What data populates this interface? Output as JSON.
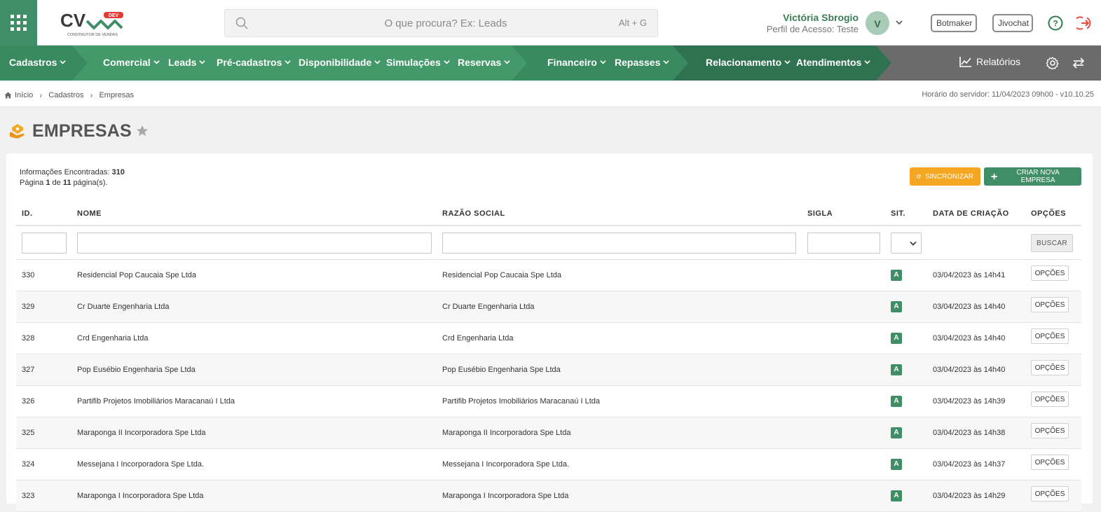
{
  "topbar": {
    "search_placeholder": "O que procura? Ex: Leads",
    "search_shortcut": "Alt + G",
    "logo_text": "CV",
    "logo_badge": "DEV",
    "logo_tagline": "CONSTRUTOR DE VENDAS",
    "user_name": "Victória Sbrogio",
    "user_profile": "Perfil de Acesso: Teste",
    "avatar_initial": "V",
    "botmaker_label": "Botmaker",
    "jivochat_label": "Jivochat"
  },
  "menu": {
    "cadastros": "Cadastros",
    "comercial": "Comercial",
    "leads": "Leads",
    "pre_cadastros": "Pré-cadastros",
    "disponibilidade": "Disponibilidade",
    "simulacoes": "Simulações",
    "reservas": "Reservas",
    "financeiro": "Financeiro",
    "repasses": "Repasses",
    "relacionamento": "Relacionamento",
    "atendimentos": "Atendimentos",
    "relatorios": "Relatórios"
  },
  "breadcrumb": {
    "home": "Início",
    "cadastros": "Cadastros",
    "current": "Empresas",
    "server_time": "Horário do servidor: 11/04/2023 09h00 - v10.10.25"
  },
  "page": {
    "title": "EMPRESAS"
  },
  "info": {
    "found_label": "Informações Encontradas:",
    "found_count": "310",
    "page_prefix": "Página",
    "page_current": "1",
    "page_of": "de",
    "page_total": "11",
    "page_suffix": "página(s)."
  },
  "actions": {
    "sync_label": "SINCRONIZAR",
    "new_label": "CRIAR NOVA EMPRESA",
    "search_label": "BUSCAR"
  },
  "table": {
    "headers": {
      "id": "ID.",
      "nome": "NOME",
      "razao": "RAZÃO SOCIAL",
      "sigla": "SIGLA",
      "sit": "SIT.",
      "data": "DATA DE CRIAÇÃO",
      "opcoes": "OPÇÕES"
    },
    "option_label": "OPÇÕES",
    "rows": [
      {
        "id": "330",
        "nome": "Residencial Pop Caucaia Spe Ltda",
        "razao": "Residencial Pop Caucaia Spe Ltda",
        "sigla": "",
        "sit": "A",
        "data": "03/04/2023 às 14h41"
      },
      {
        "id": "329",
        "nome": "Cr Duarte Engenharia Ltda",
        "razao": "Cr Duarte Engenharia Ltda",
        "sigla": "",
        "sit": "A",
        "data": "03/04/2023 às 14h40"
      },
      {
        "id": "328",
        "nome": "Crd Engenharia Ltda",
        "razao": "Crd Engenharia Ltda",
        "sigla": "",
        "sit": "A",
        "data": "03/04/2023 às 14h40"
      },
      {
        "id": "327",
        "nome": "Pop Eusébio Engenharia Spe Ltda",
        "razao": "Pop Eusébio Engenharia Spe Ltda",
        "sigla": "",
        "sit": "A",
        "data": "03/04/2023 às 14h40"
      },
      {
        "id": "326",
        "nome": "Partifib Projetos Imobiliários Maracanaú I Ltda",
        "razao": "Partifib Projetos Imobiliários Maracanaú I Ltda",
        "sigla": "",
        "sit": "A",
        "data": "03/04/2023 às 14h39"
      },
      {
        "id": "325",
        "nome": "Maraponga II Incorporadora Spe Ltda",
        "razao": "Maraponga II Incorporadora Spe Ltda",
        "sigla": "",
        "sit": "A",
        "data": "03/04/2023 às 14h38"
      },
      {
        "id": "324",
        "nome": "Messejana I Incorporadora Spe Ltda.",
        "razao": "Messejana I Incorporadora Spe Ltda.",
        "sigla": "",
        "sit": "A",
        "data": "03/04/2023 às 14h37"
      },
      {
        "id": "323",
        "nome": "Maraponga I Incorporadora Spe Ltda",
        "razao": "Maraponga I Incorporadora Spe Ltda",
        "sigla": "",
        "sit": "A",
        "data": "03/04/2023 às 14h29"
      }
    ]
  },
  "colors": {
    "brand_green": "#3f8e67",
    "menu_green_light": "#48a06f",
    "menu_green_dark": "#2f7250",
    "sync_orange": "#f5a623",
    "logout_red": "#e74c3c"
  }
}
